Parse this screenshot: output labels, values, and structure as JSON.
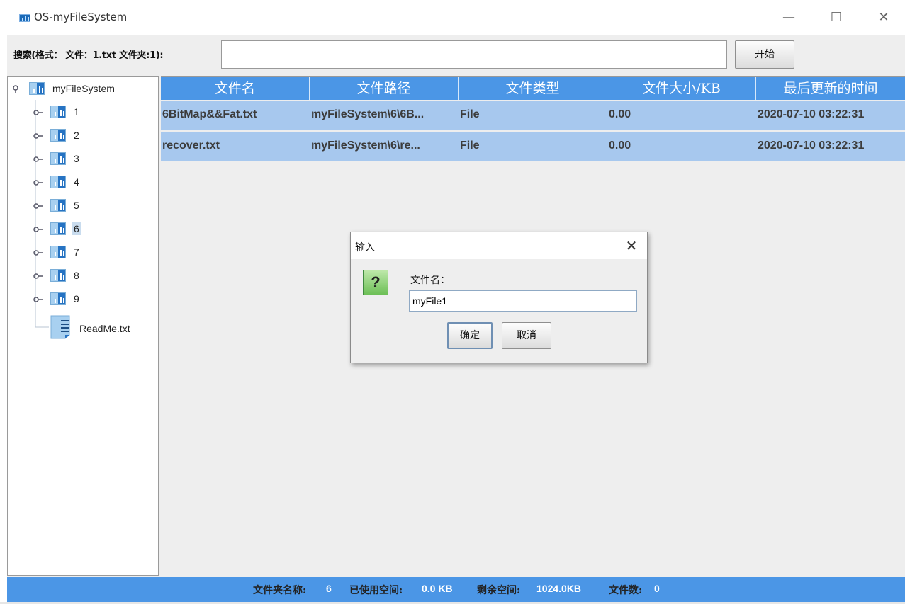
{
  "window": {
    "title": "OS-myFileSystem",
    "controls": {
      "minimize": "—",
      "maximize": "☐",
      "close": "✕"
    }
  },
  "search": {
    "label": "搜索(格式： 文件：1.txt 文件夹:1):",
    "value": "",
    "start_label": "开始"
  },
  "tree": {
    "root": "myFileSystem",
    "folders": [
      "1",
      "2",
      "3",
      "4",
      "5",
      "6",
      "7",
      "8",
      "9"
    ],
    "selected_folder": "6",
    "file": "ReadMe.txt"
  },
  "table": {
    "headers": [
      "文件名",
      "文件路径",
      "文件类型",
      "文件大小/KB",
      "最后更新的时间"
    ],
    "rows": [
      {
        "name": "6BitMap&&Fat.txt",
        "path": "myFileSystem\\6\\6B...",
        "type": "File",
        "size": "0.00",
        "modified": "2020-07-10 03:22:31"
      },
      {
        "name": "recover.txt",
        "path": "myFileSystem\\6\\re...",
        "type": "File",
        "size": "0.00",
        "modified": "2020-07-10 03:22:31"
      }
    ]
  },
  "status": {
    "folder_label": "文件夹名称:",
    "folder_value": "6",
    "used_label": "已使用空间:",
    "used_value": "0.0 KB",
    "free_label": "剩余空间:",
    "free_value": "1024.0KB",
    "count_label": "文件数:",
    "count_value": "0"
  },
  "dialog": {
    "title": "输入",
    "close": "✕",
    "icon_glyph": "?",
    "label": "文件名：",
    "input_value": "myFile1",
    "ok_label": "确定",
    "cancel_label": "取消"
  },
  "colors": {
    "accent": "#4b96e6",
    "row_highlight": "#a7c8ee",
    "folder_icon": "#2673c3"
  }
}
